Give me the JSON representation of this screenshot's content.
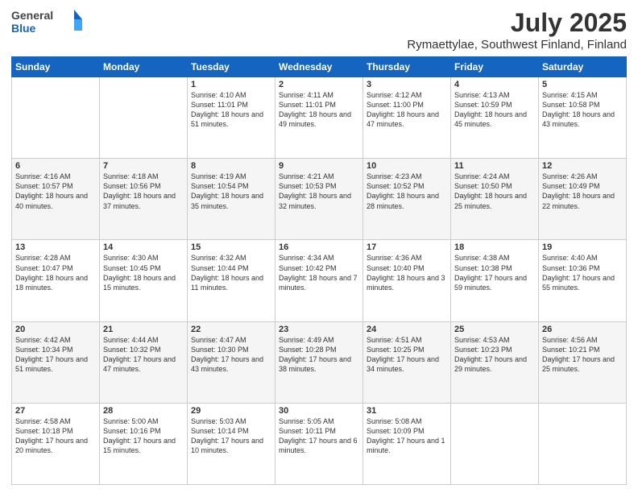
{
  "header": {
    "logo": {
      "general": "General",
      "blue": "Blue"
    },
    "month": "July 2025",
    "location": "Rymaettylae, Southwest Finland, Finland"
  },
  "weekdays": [
    "Sunday",
    "Monday",
    "Tuesday",
    "Wednesday",
    "Thursday",
    "Friday",
    "Saturday"
  ],
  "weeks": [
    [
      {
        "day": "",
        "sunrise": "",
        "sunset": "",
        "daylight": ""
      },
      {
        "day": "",
        "sunrise": "",
        "sunset": "",
        "daylight": ""
      },
      {
        "day": "1",
        "sunrise": "Sunrise: 4:10 AM",
        "sunset": "Sunset: 11:01 PM",
        "daylight": "Daylight: 18 hours and 51 minutes."
      },
      {
        "day": "2",
        "sunrise": "Sunrise: 4:11 AM",
        "sunset": "Sunset: 11:01 PM",
        "daylight": "Daylight: 18 hours and 49 minutes."
      },
      {
        "day": "3",
        "sunrise": "Sunrise: 4:12 AM",
        "sunset": "Sunset: 11:00 PM",
        "daylight": "Daylight: 18 hours and 47 minutes."
      },
      {
        "day": "4",
        "sunrise": "Sunrise: 4:13 AM",
        "sunset": "Sunset: 10:59 PM",
        "daylight": "Daylight: 18 hours and 45 minutes."
      },
      {
        "day": "5",
        "sunrise": "Sunrise: 4:15 AM",
        "sunset": "Sunset: 10:58 PM",
        "daylight": "Daylight: 18 hours and 43 minutes."
      }
    ],
    [
      {
        "day": "6",
        "sunrise": "Sunrise: 4:16 AM",
        "sunset": "Sunset: 10:57 PM",
        "daylight": "Daylight: 18 hours and 40 minutes."
      },
      {
        "day": "7",
        "sunrise": "Sunrise: 4:18 AM",
        "sunset": "Sunset: 10:56 PM",
        "daylight": "Daylight: 18 hours and 37 minutes."
      },
      {
        "day": "8",
        "sunrise": "Sunrise: 4:19 AM",
        "sunset": "Sunset: 10:54 PM",
        "daylight": "Daylight: 18 hours and 35 minutes."
      },
      {
        "day": "9",
        "sunrise": "Sunrise: 4:21 AM",
        "sunset": "Sunset: 10:53 PM",
        "daylight": "Daylight: 18 hours and 32 minutes."
      },
      {
        "day": "10",
        "sunrise": "Sunrise: 4:23 AM",
        "sunset": "Sunset: 10:52 PM",
        "daylight": "Daylight: 18 hours and 28 minutes."
      },
      {
        "day": "11",
        "sunrise": "Sunrise: 4:24 AM",
        "sunset": "Sunset: 10:50 PM",
        "daylight": "Daylight: 18 hours and 25 minutes."
      },
      {
        "day": "12",
        "sunrise": "Sunrise: 4:26 AM",
        "sunset": "Sunset: 10:49 PM",
        "daylight": "Daylight: 18 hours and 22 minutes."
      }
    ],
    [
      {
        "day": "13",
        "sunrise": "Sunrise: 4:28 AM",
        "sunset": "Sunset: 10:47 PM",
        "daylight": "Daylight: 18 hours and 18 minutes."
      },
      {
        "day": "14",
        "sunrise": "Sunrise: 4:30 AM",
        "sunset": "Sunset: 10:45 PM",
        "daylight": "Daylight: 18 hours and 15 minutes."
      },
      {
        "day": "15",
        "sunrise": "Sunrise: 4:32 AM",
        "sunset": "Sunset: 10:44 PM",
        "daylight": "Daylight: 18 hours and 11 minutes."
      },
      {
        "day": "16",
        "sunrise": "Sunrise: 4:34 AM",
        "sunset": "Sunset: 10:42 PM",
        "daylight": "Daylight: 18 hours and 7 minutes."
      },
      {
        "day": "17",
        "sunrise": "Sunrise: 4:36 AM",
        "sunset": "Sunset: 10:40 PM",
        "daylight": "Daylight: 18 hours and 3 minutes."
      },
      {
        "day": "18",
        "sunrise": "Sunrise: 4:38 AM",
        "sunset": "Sunset: 10:38 PM",
        "daylight": "Daylight: 17 hours and 59 minutes."
      },
      {
        "day": "19",
        "sunrise": "Sunrise: 4:40 AM",
        "sunset": "Sunset: 10:36 PM",
        "daylight": "Daylight: 17 hours and 55 minutes."
      }
    ],
    [
      {
        "day": "20",
        "sunrise": "Sunrise: 4:42 AM",
        "sunset": "Sunset: 10:34 PM",
        "daylight": "Daylight: 17 hours and 51 minutes."
      },
      {
        "day": "21",
        "sunrise": "Sunrise: 4:44 AM",
        "sunset": "Sunset: 10:32 PM",
        "daylight": "Daylight: 17 hours and 47 minutes."
      },
      {
        "day": "22",
        "sunrise": "Sunrise: 4:47 AM",
        "sunset": "Sunset: 10:30 PM",
        "daylight": "Daylight: 17 hours and 43 minutes."
      },
      {
        "day": "23",
        "sunrise": "Sunrise: 4:49 AM",
        "sunset": "Sunset: 10:28 PM",
        "daylight": "Daylight: 17 hours and 38 minutes."
      },
      {
        "day": "24",
        "sunrise": "Sunrise: 4:51 AM",
        "sunset": "Sunset: 10:25 PM",
        "daylight": "Daylight: 17 hours and 34 minutes."
      },
      {
        "day": "25",
        "sunrise": "Sunrise: 4:53 AM",
        "sunset": "Sunset: 10:23 PM",
        "daylight": "Daylight: 17 hours and 29 minutes."
      },
      {
        "day": "26",
        "sunrise": "Sunrise: 4:56 AM",
        "sunset": "Sunset: 10:21 PM",
        "daylight": "Daylight: 17 hours and 25 minutes."
      }
    ],
    [
      {
        "day": "27",
        "sunrise": "Sunrise: 4:58 AM",
        "sunset": "Sunset: 10:18 PM",
        "daylight": "Daylight: 17 hours and 20 minutes."
      },
      {
        "day": "28",
        "sunrise": "Sunrise: 5:00 AM",
        "sunset": "Sunset: 10:16 PM",
        "daylight": "Daylight: 17 hours and 15 minutes."
      },
      {
        "day": "29",
        "sunrise": "Sunrise: 5:03 AM",
        "sunset": "Sunset: 10:14 PM",
        "daylight": "Daylight: 17 hours and 10 minutes."
      },
      {
        "day": "30",
        "sunrise": "Sunrise: 5:05 AM",
        "sunset": "Sunset: 10:11 PM",
        "daylight": "Daylight: 17 hours and 6 minutes."
      },
      {
        "day": "31",
        "sunrise": "Sunrise: 5:08 AM",
        "sunset": "Sunset: 10:09 PM",
        "daylight": "Daylight: 17 hours and 1 minute."
      },
      {
        "day": "",
        "sunrise": "",
        "sunset": "",
        "daylight": ""
      },
      {
        "day": "",
        "sunrise": "",
        "sunset": "",
        "daylight": ""
      }
    ]
  ]
}
